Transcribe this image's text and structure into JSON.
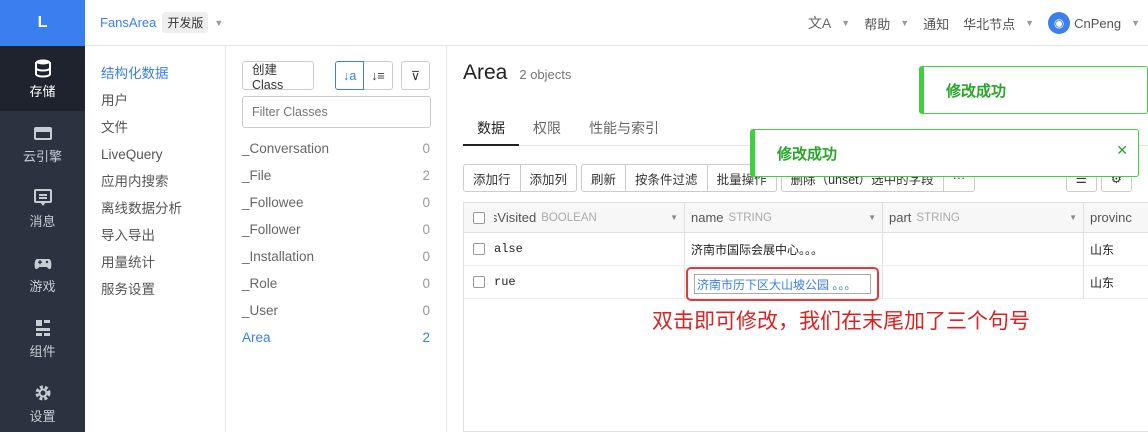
{
  "rail": {
    "logo": "L",
    "items": [
      {
        "label": "存储",
        "icon": "database-icon"
      },
      {
        "label": "云引擎",
        "icon": "server-icon"
      },
      {
        "label": "消息",
        "icon": "message-icon"
      },
      {
        "label": "游戏",
        "icon": "gamepad-icon"
      },
      {
        "label": "组件",
        "icon": "components-icon"
      },
      {
        "label": "设置",
        "icon": "gear-icon"
      }
    ]
  },
  "topbar": {
    "app_name": "FansArea",
    "env": "开发版",
    "translate_icon": "translate-icon",
    "help": "帮助",
    "notify": "通知",
    "region": "华北节点",
    "user": "CnPeng"
  },
  "nav2": {
    "items": [
      "结构化数据",
      "用户",
      "文件",
      "LiveQuery",
      "应用内搜索",
      "离线数据分析",
      "导入导出",
      "用量统计",
      "服务设置"
    ]
  },
  "classes": {
    "create_label": "创建 Class",
    "filter_placeholder": "Filter Classes",
    "list": [
      {
        "name": "_Conversation",
        "count": "0"
      },
      {
        "name": "_File",
        "count": "2"
      },
      {
        "name": "_Followee",
        "count": "0"
      },
      {
        "name": "_Follower",
        "count": "0"
      },
      {
        "name": "_Installation",
        "count": "0"
      },
      {
        "name": "_Role",
        "count": "0"
      },
      {
        "name": "_User",
        "count": "0"
      },
      {
        "name": "Area",
        "count": "2"
      }
    ]
  },
  "main": {
    "title": "Area",
    "count": "2 objects",
    "tabs": [
      "数据",
      "权限",
      "性能与索引"
    ],
    "toolbar": {
      "add_row": "添加行",
      "add_col": "添加列",
      "refresh": "刷新",
      "filter": "按条件过滤",
      "batch": "批量操作",
      "delete_field": "删除（unset）选中的字段",
      "more": "···"
    },
    "columns": [
      {
        "name": "isVisited",
        "type": "BOOLEAN"
      },
      {
        "name": "name",
        "type": "STRING"
      },
      {
        "name": "part",
        "type": "STRING"
      },
      {
        "name": "provinc"
      }
    ],
    "rows": [
      {
        "visited": "alse",
        "name": "济南市国际会展中心。。。",
        "part": "",
        "province": "山东"
      },
      {
        "visited": "rue",
        "name": "济南市历下区大山坡公园 。。。",
        "part": "",
        "province": "山东"
      }
    ]
  },
  "annotation": "双击即可修改，我们在末尾加了三个句号",
  "toasts": [
    "修改成功",
    "修改成功"
  ]
}
